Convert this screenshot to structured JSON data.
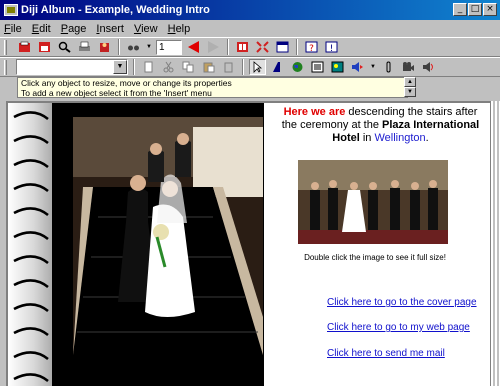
{
  "window": {
    "title": "Diji Album - Example, Wedding Intro",
    "controls": [
      "_",
      "□",
      "×"
    ]
  },
  "menu": [
    "File",
    "Edit",
    "Page",
    "Insert",
    "View",
    "Help"
  ],
  "toolbar1": {
    "page_value": "1",
    "icons": [
      "open-album-icon",
      "save-album-icon",
      "find-icon",
      "print-icon",
      "wizard-icon",
      "binoculars-icon",
      "previous-page-icon",
      "next-page-icon",
      "page-view-icon",
      "fit-page-icon",
      "full-screen-icon",
      "help-topics-icon",
      "context-help-icon"
    ]
  },
  "toolbar2": {
    "combo_value": "",
    "icons": [
      "new-page-icon",
      "cut-icon",
      "copy-icon",
      "paste-icon",
      "delete-icon",
      "pointer-icon",
      "text-icon",
      "globe-icon",
      "picture-icon",
      "image-icon",
      "sound-icon",
      "attach-icon",
      "video-icon",
      "speaker-icon"
    ]
  },
  "hint": {
    "line1": "Click any object to resize, move or change its properties",
    "line2": "To add a new object select it from the 'Insert' menu"
  },
  "page": {
    "intro_highlight": "Here we are",
    "intro_text": " descending the stairs after the ceremony at the ",
    "venue": "Plaza International Hotel",
    "in_text": " in ",
    "city": "Wellington",
    "period": ".",
    "thumb_caption": "Double click the image to see it full size!",
    "links": [
      "Click here to go to the cover page",
      "Click here to go to my web page",
      "Click here to send me mail"
    ]
  },
  "colors": {
    "title_start": "#000080",
    "title_end": "#1084d0",
    "highlight": "#e00000",
    "link": "#1010cc"
  }
}
